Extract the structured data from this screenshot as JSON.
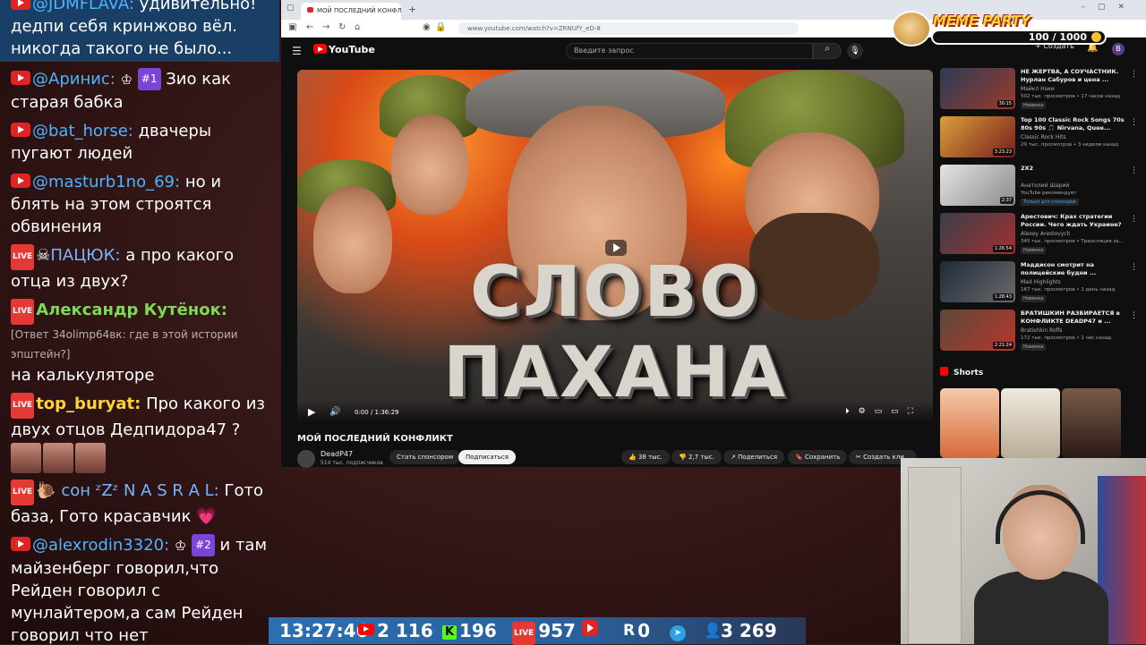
{
  "chat": {
    "messages": [
      {
        "nick": "@JDMFLAVA:",
        "text": "удивительно! дедпи себя кринжово вёл. никогда такого не было..."
      },
      {
        "nick": "@Аринис:",
        "rank": "#1",
        "text": "Зио как старая бабка"
      },
      {
        "nick": "@bat_horse:",
        "text": "двачеры пугают людей"
      },
      {
        "nick": "@masturb1no_69:",
        "text": "но и блять на этом строятся обвинения"
      },
      {
        "nick": "ПАЦЮК:",
        "text": "а про какого отца из двух?"
      },
      {
        "nick": "Александр Кутёнок:",
        "reply": "[Ответ 34olimp64вк: где в этой истории эпштейн?]",
        "text": "на калькуляторе"
      },
      {
        "nick": "top_buryat:",
        "text": "Про какого из двух отцов Дедпидора47 ?"
      },
      {
        "nick": "сон ᶻZᶻ N A S R A L:",
        "text": "Гото база, Гото красавчик"
      },
      {
        "nick": "@alexrodin3320:",
        "rank": "#2",
        "text": "и там майзенберг говорил,что Рейден говорил с мунлайтером,а сам Рейден говорил что нет"
      }
    ],
    "live_badge": "LIVE"
  },
  "browser": {
    "tab_title": "МОЙ ПОСЛЕДНИЙ КОНФЛИКТ",
    "url": "www.youtube.com/watch?v=ZRNUfY_eD-8",
    "youtube_logo": "YouTube",
    "search_placeholder": "Введите запрос",
    "create_label": "+ Создать",
    "avatar_letter": "В"
  },
  "video": {
    "thumbnail_text": "СЛОВО ПАХАНА",
    "time": "0:00 / 1:36:29",
    "title": "МОЙ ПОСЛЕДНИЙ КОНФЛИКТ",
    "channel": "DeadP47",
    "subscribers": "514 тыс. подписчиков",
    "sponsor_label": "Стать спонсором",
    "subscribe_label": "Подписаться",
    "likes": "38 тыс.",
    "dislikes": "2,7 тыс.",
    "share_label": "Поделиться",
    "save_label": "Сохранить",
    "clip_label": "Создать кли..."
  },
  "recommendations": [
    {
      "title": "НЕ ЖЕРТВА, А СОУЧАСТНИК. Нурлан Сабуров и цена ...",
      "channel": "Майкл Наки",
      "meta": "502 тыс. просмотров • 17 часов назад",
      "badge": "Новинка",
      "duration": "30:15"
    },
    {
      "title": "Top 100 Classic Rock Songs 70s 80s 90s 🎵 Nirvana, Quee...",
      "channel": "Classic Rock Hits",
      "meta": "29 тыс. просмотров • 3 недели назад",
      "badge": "",
      "duration": "3:23:23"
    },
    {
      "title": "2X2",
      "channel": "Анатолий Шарий",
      "meta": "YouTube рекомендует",
      "badge": "Только для спонсоров",
      "duration": "2:37"
    },
    {
      "title": "Арестович: Крах стратегии России. Чего ждать Украине?",
      "channel": "Alexey Arestovych",
      "meta": "345 тыс. просмотров • Трансляция за...",
      "badge": "Новинка",
      "duration": "1:26:54"
    },
    {
      "title": "Мэддисон смотрит на полицейские будни ...",
      "channel": "Mad Highlights",
      "meta": "167 тыс. просмотров • 1 день назад",
      "badge": "Новинка",
      "duration": "1:28:43"
    },
    {
      "title": "БРАТИШКИН РАЗБИРАЕТСЯ в КОНФЛИКТЕ DEADP47 и ...",
      "channel": "Bratishkin Rofls",
      "meta": "172 тыс. просмотров • 1 час назад",
      "badge": "Новинка",
      "duration": "2:21:24"
    }
  ],
  "shorts": {
    "heading": "Shorts"
  },
  "overlay": {
    "meme_title": "MEME PARTY",
    "meme_progress": "100 / 1000"
  },
  "stats": {
    "clock": "13:27:46",
    "youtube": "2 116",
    "kick": "196",
    "live": "957",
    "rutube": "0",
    "telegram": "3 269"
  },
  "colors": {
    "youtube_red": "#ff0000",
    "chat_nick_blue": "#4fb3ff",
    "kick_green": "#53fc18",
    "stats_bar": "#2b6fb3"
  }
}
